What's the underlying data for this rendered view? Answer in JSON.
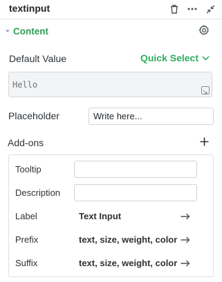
{
  "header": {
    "title": "textinput",
    "icons": [
      "trash-icon",
      "more-icon",
      "collapse-icon"
    ]
  },
  "section": {
    "label": "Content",
    "icon": "gear-icon"
  },
  "default_value": {
    "label": "Default Value",
    "quick_select": "Quick Select",
    "value": "Hello"
  },
  "placeholder": {
    "label": "Placeholder",
    "value": "Write here..."
  },
  "addons": {
    "label": "Add-ons",
    "rows": [
      {
        "label": "Tooltip",
        "value": ""
      },
      {
        "label": "Description",
        "value": ""
      },
      {
        "label": "Label",
        "value": "Text Input"
      },
      {
        "label": "Prefix",
        "value": "text, size, weight, color"
      },
      {
        "label": "Suffix",
        "value": "text, size, weight, color"
      }
    ]
  },
  "colors": {
    "accent": "#2fae62",
    "section_label": "#2f9e57"
  }
}
